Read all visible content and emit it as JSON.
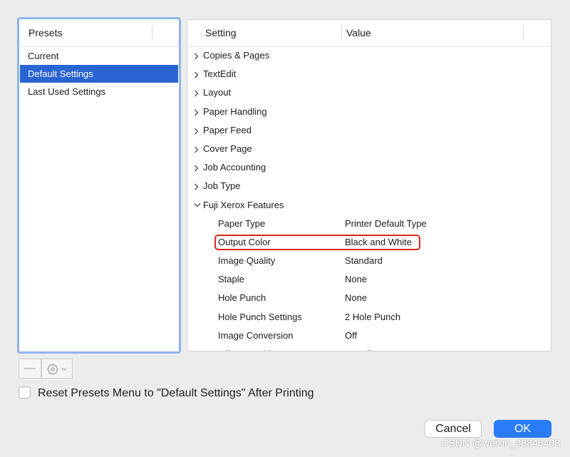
{
  "presets": {
    "header": "Presets",
    "items": [
      {
        "label": "Current",
        "selected": false
      },
      {
        "label": "Default Settings",
        "selected": true
      },
      {
        "label": "Last Used Settings",
        "selected": false
      }
    ]
  },
  "settings": {
    "columns": {
      "setting": "Setting",
      "value": "Value"
    },
    "groups": [
      {
        "label": "Copies & Pages",
        "expanded": false
      },
      {
        "label": "TextEdit",
        "expanded": false
      },
      {
        "label": "Layout",
        "expanded": false
      },
      {
        "label": "Paper Handling",
        "expanded": false
      },
      {
        "label": "Paper Feed",
        "expanded": false
      },
      {
        "label": "Cover Page",
        "expanded": false
      },
      {
        "label": "Job Accounting",
        "expanded": false
      },
      {
        "label": "Job Type",
        "expanded": false
      },
      {
        "label": "Fuji Xerox Features",
        "expanded": true,
        "children": [
          {
            "label": "Paper Type",
            "value": "Printer Default Type"
          },
          {
            "label": "Output Color",
            "value": "Black and White",
            "highlighted": true
          },
          {
            "label": "Image Quality",
            "value": "Standard"
          },
          {
            "label": "Staple",
            "value": "None"
          },
          {
            "label": "Hole Punch",
            "value": "None"
          },
          {
            "label": "Hole Punch Settings",
            "value": "2 Hole Punch"
          },
          {
            "label": "Image Conversion",
            "value": "Off"
          },
          {
            "label": "Offset Stacking",
            "value": "No Offset"
          }
        ]
      }
    ]
  },
  "toolbar": {
    "remove_label": "—",
    "action_icon": "gear-icon"
  },
  "reset_checkbox": {
    "label": "Reset Presets Menu to \"Default Settings\" After Printing",
    "checked": false
  },
  "buttons": {
    "cancel": "Cancel",
    "ok": "OK"
  },
  "watermark": "CSDN @weixin_43846408",
  "colors": {
    "accent": "#2a7cf6",
    "selection": "#2a63d4",
    "focus_ring": "#8eb3f0",
    "highlight": "#d8281e"
  }
}
